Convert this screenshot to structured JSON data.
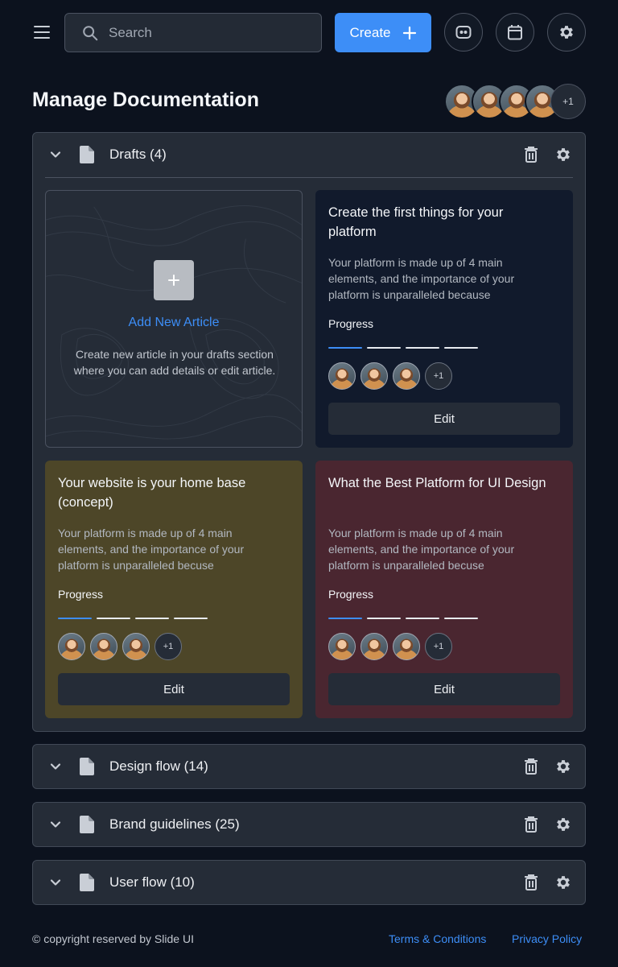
{
  "colors": {
    "background": "#0c121e",
    "panel": "#252c37",
    "accent": "#3d8ef7",
    "card_dark": "#111a2c",
    "card_olive": "#4d4628",
    "card_wine": "#4a2630"
  },
  "header": {
    "menu_icon": "hamburger-menu-icon",
    "search": {
      "placeholder": "Search",
      "value": ""
    },
    "create_label": "Create",
    "icons": [
      "chat-icon",
      "calendar-icon",
      "gear-icon"
    ]
  },
  "page": {
    "title": "Manage Documentation",
    "team_more": "+1"
  },
  "drafts": {
    "title": "Drafts (4)",
    "add_card": {
      "link": "Add New Article",
      "description": "Create new article in your drafts section where you can add details or edit article."
    },
    "cards": [
      {
        "title": "Create the first things for your platform",
        "description": "Your platform is made up of 4 main elements, and the importance of your platform is unparalleled because",
        "progress_label": "Progress",
        "progress_steps_done": 1,
        "progress_steps_total": 4,
        "more": "+1",
        "edit": "Edit",
        "color": "#111a2c"
      },
      {
        "title": "Your website is your home base (concept)",
        "description": "Your platform is made up of 4 main elements, and the importance of your platform is unparalleled becuse",
        "progress_label": "Progress",
        "progress_steps_done": 1,
        "progress_steps_total": 4,
        "more": "+1",
        "edit": "Edit",
        "color": "#4d4628"
      },
      {
        "title": "What the Best Platform for UI Design",
        "description": "Your platform is made up of 4 main elements, and the importance of your platform is unparalleled becuse",
        "progress_label": "Progress",
        "progress_steps_done": 1,
        "progress_steps_total": 4,
        "more": "+1",
        "edit": "Edit",
        "color": "#4a2630"
      }
    ]
  },
  "sections": [
    {
      "title": "Design flow (14)"
    },
    {
      "title": "Brand guidelines (25)"
    },
    {
      "title": "User flow (10)"
    }
  ],
  "footer": {
    "copyright": "© copyright reserved by Slide UI",
    "terms": "Terms & Conditions",
    "privacy": "Privacy Policy"
  }
}
